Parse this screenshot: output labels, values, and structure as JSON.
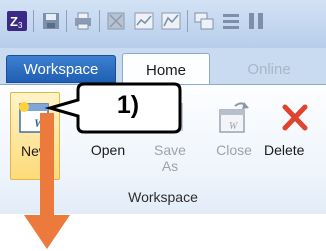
{
  "quick_access": {
    "icons": [
      "app-logo-icon",
      "save-icon",
      "print-icon",
      "disabled-icon",
      "chart-icon",
      "chart-icon",
      "window-icon",
      "list-icon",
      "columns-icon"
    ]
  },
  "tabs": [
    {
      "label": "Workspace",
      "active": false
    },
    {
      "label": "Home",
      "active": true
    },
    {
      "label": "Online",
      "active": false
    }
  ],
  "ribbon": {
    "buttons": [
      {
        "label": "New",
        "enabled": true
      },
      {
        "label": "Open",
        "enabled": true
      },
      {
        "label": "Save\nAs",
        "enabled": false
      },
      {
        "label": "Close",
        "enabled": false
      },
      {
        "label": "Delete",
        "enabled": true
      }
    ],
    "group_label": "Workspace"
  },
  "callout": {
    "text": "1)"
  },
  "colors": {
    "workspace_tab": "#2b6cc4",
    "arrow": "#ec7a3c",
    "delete_x": "#e0432e",
    "callout_fill": "#ffffff"
  }
}
